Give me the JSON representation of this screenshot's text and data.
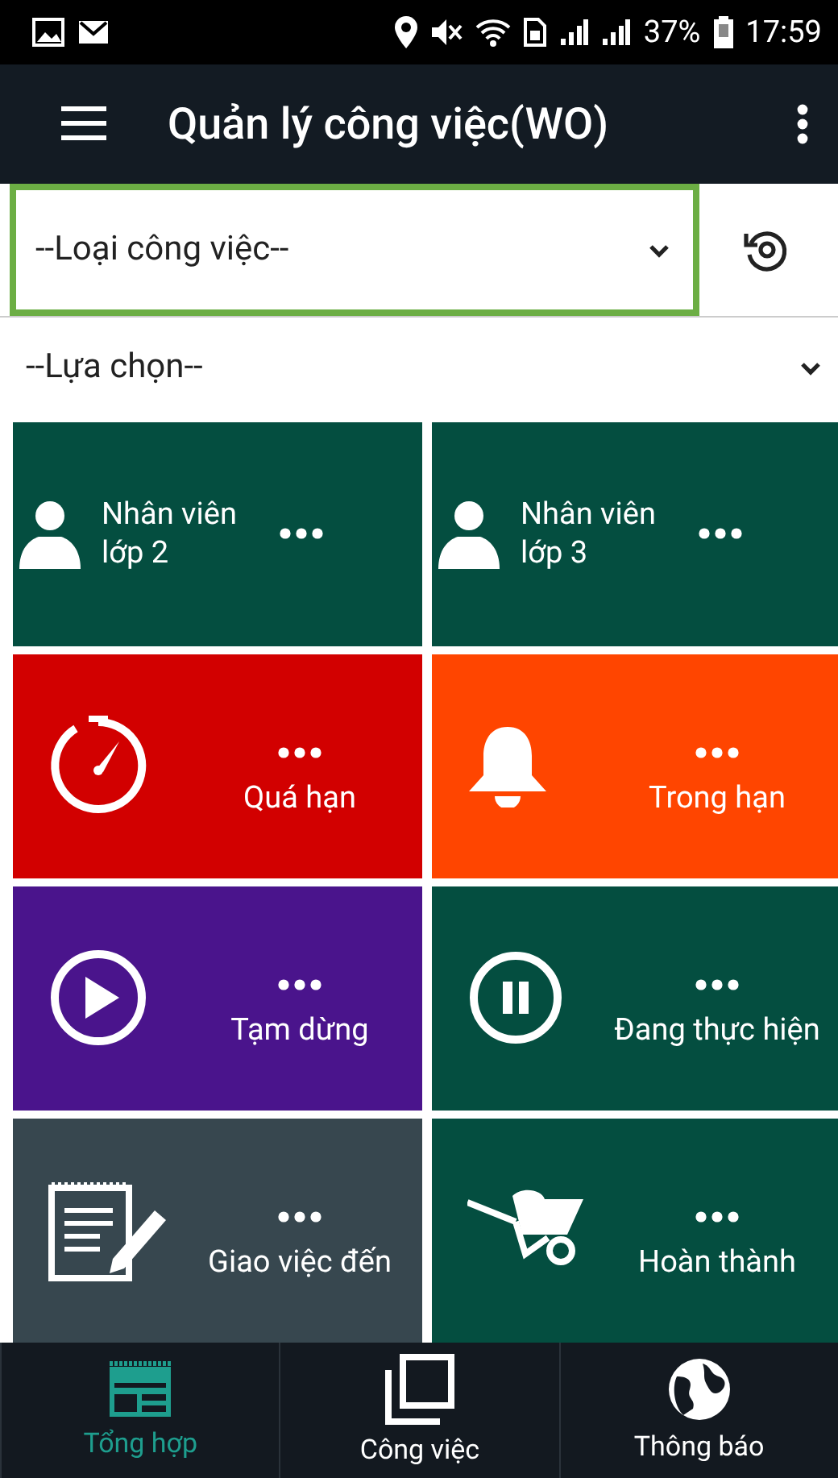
{
  "status_bar": {
    "battery": "37%",
    "time": "17:59"
  },
  "app_bar": {
    "title": "Quản lý công việc(WO)"
  },
  "filters": [
    {
      "placeholder": "--Loại công việc--",
      "highlighted": true
    },
    {
      "placeholder": "--Lựa chọn--",
      "highlighted": false
    }
  ],
  "tiles": [
    {
      "kind": "person",
      "label": "Nhân viên lớp 2",
      "color": "#044e40"
    },
    {
      "kind": "person",
      "label": "Nhân viên lớp 3",
      "color": "#044e40"
    },
    {
      "kind": "status",
      "label": "Quá hạn",
      "color": "#d20000"
    },
    {
      "kind": "status",
      "label": "Trong hạn",
      "color": "#ff4500"
    },
    {
      "kind": "status",
      "label": "Tạm dừng",
      "color": "#4a148c"
    },
    {
      "kind": "status",
      "label": "Đang thực hiện",
      "color": "#044e40"
    },
    {
      "kind": "status",
      "label": "Giao việc đến",
      "color": "#37474f"
    },
    {
      "kind": "status",
      "label": "Hoàn thành",
      "color": "#044e40"
    }
  ],
  "bottom_nav": [
    {
      "label": "Tổng hợp",
      "selected": true
    },
    {
      "label": "Công việc",
      "selected": false
    },
    {
      "label": "Thông báo",
      "selected": false
    }
  ]
}
